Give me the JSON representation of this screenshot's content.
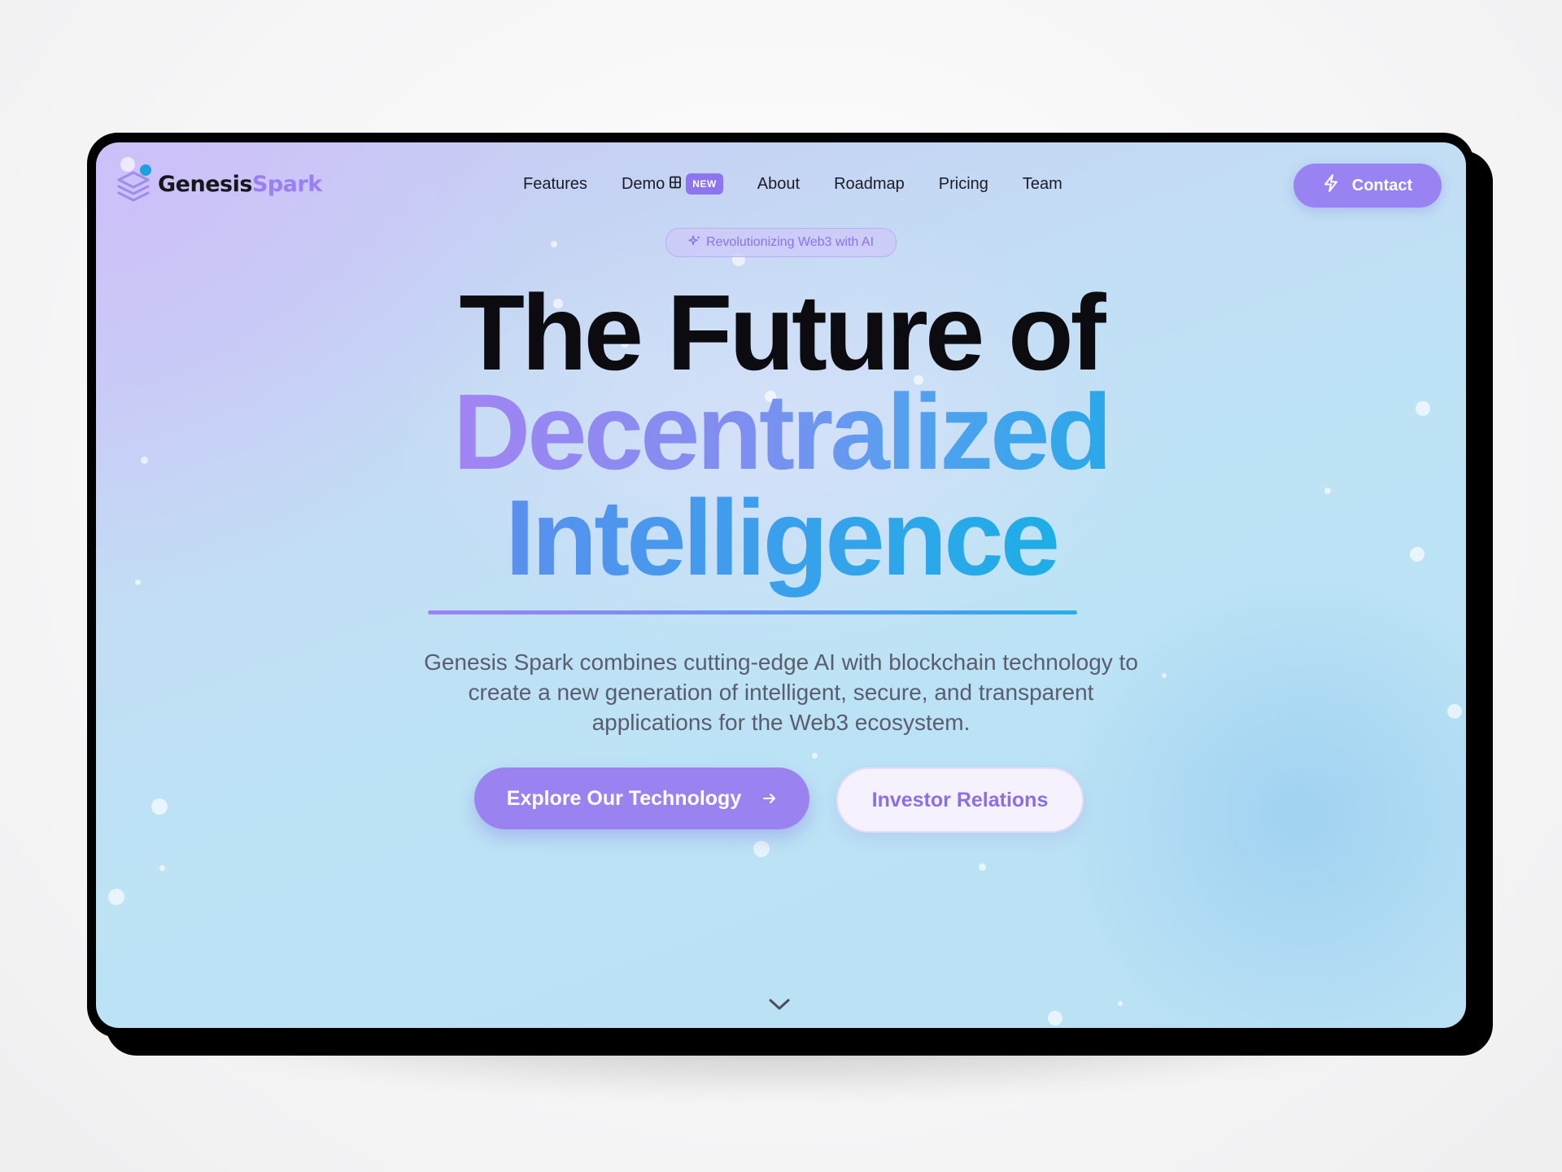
{
  "brand": {
    "name_part1": "Genesis",
    "name_part2": "Spark"
  },
  "nav": {
    "links": [
      {
        "label": "Features"
      },
      {
        "label": "Demo",
        "badge": "NEW"
      },
      {
        "label": "About"
      },
      {
        "label": "Roadmap"
      },
      {
        "label": "Pricing"
      },
      {
        "label": "Team"
      }
    ],
    "contact_label": "Contact"
  },
  "hero": {
    "pill": "Revolutionizing Web3 with AI",
    "line1": "The Future of",
    "line2": "Decentralized",
    "line3": "Intelligence",
    "subtitle": "Genesis Spark combines cutting-edge AI with blockchain technology to create a new generation of intelligent, secure, and transparent applications for the Web3 ecosystem.",
    "primary_button": "Explore Our Technology",
    "secondary_button": "Investor Relations"
  },
  "icons": {
    "logo": "layers-stack-icon",
    "demo": "film-icon",
    "contact": "lightning-icon",
    "pill": "sparkles-icon",
    "primary_button": "arrow-right-icon",
    "scroll": "chevron-down-icon"
  },
  "colors": {
    "accent": "#9a82f1",
    "gradient_start": "#a284f3",
    "gradient_end": "#2aa8e8",
    "headline_dark": "#0c0c10",
    "body_text": "#5a5d6e"
  }
}
